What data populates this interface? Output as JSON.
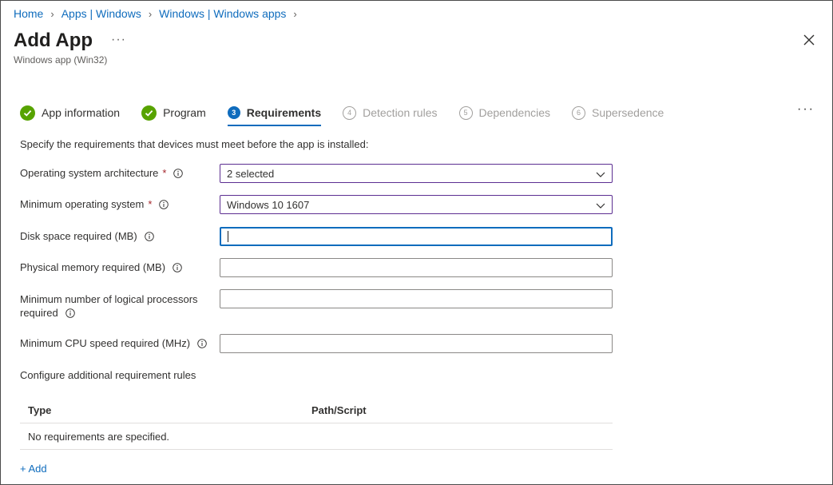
{
  "breadcrumb": [
    "Home",
    "Apps | Windows",
    "Windows | Windows apps"
  ],
  "header": {
    "title": "Add App",
    "more": "···",
    "subtitle": "Windows app (Win32)"
  },
  "steps": [
    {
      "label": "App information",
      "state": "done"
    },
    {
      "label": "Program",
      "state": "done"
    },
    {
      "num": "3",
      "label": "Requirements",
      "state": "active"
    },
    {
      "num": "4",
      "label": "Detection rules",
      "state": "future"
    },
    {
      "num": "5",
      "label": "Dependencies",
      "state": "future"
    },
    {
      "num": "6",
      "label": "Supersedence",
      "state": "future"
    }
  ],
  "steps_more": "···",
  "intro": "Specify the requirements that devices must meet before the app is installed:",
  "form": {
    "os_arch": {
      "label": "Operating system architecture",
      "required": "*",
      "value": "2 selected"
    },
    "min_os": {
      "label": "Minimum operating system",
      "required": "*",
      "value": "Windows 10 1607"
    },
    "disk_space": {
      "label": "Disk space required (MB)",
      "value": ""
    },
    "memory": {
      "label": "Physical memory required (MB)",
      "value": ""
    },
    "processors": {
      "label_line1": "Minimum number of logical processors",
      "label_line2": "required",
      "value": ""
    },
    "cpu_speed": {
      "label": "Minimum CPU speed required (MHz)",
      "value": ""
    }
  },
  "rules": {
    "heading": "Configure additional requirement rules",
    "col_type": "Type",
    "col_path": "Path/Script",
    "empty": "No requirements are specified.",
    "add": "+ Add"
  },
  "colors": {
    "accent": "#0f6cbd",
    "success": "#57a300",
    "required": "#a4262c",
    "select_border": "#5c2e91"
  }
}
